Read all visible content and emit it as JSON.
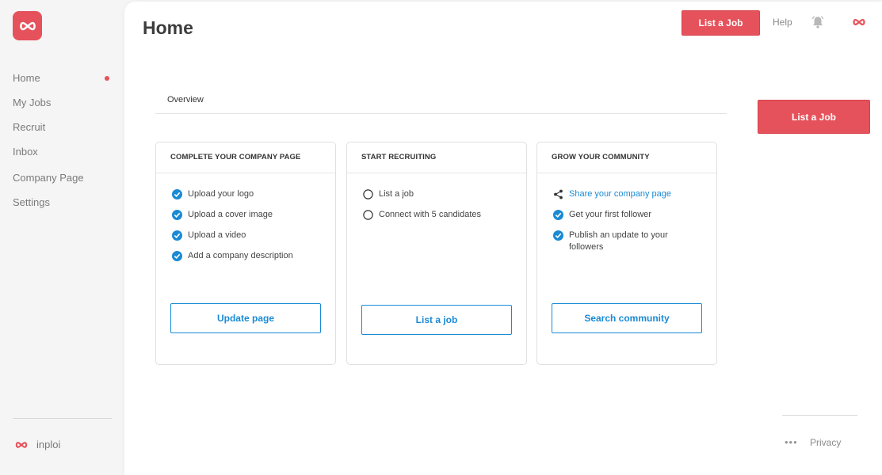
{
  "sidebar": {
    "items": [
      {
        "label": "Home"
      },
      {
        "label": "My Jobs"
      },
      {
        "label": "Recruit"
      },
      {
        "label": "Inbox"
      },
      {
        "label": "Company Page"
      },
      {
        "label": "Settings"
      }
    ],
    "brand": "inploi"
  },
  "header": {
    "title": "Home",
    "list_job": "List a Job",
    "help": "Help"
  },
  "tabs": [
    {
      "label": "Overview"
    }
  ],
  "side_button": "List a Job",
  "cards": [
    {
      "title": "COMPLETE YOUR COMPANY PAGE",
      "items": [
        {
          "text": "Upload your logo",
          "icon": "check-circle-icon"
        },
        {
          "text": "Upload a cover image",
          "icon": "check-circle-icon"
        },
        {
          "text": "Upload a video",
          "icon": "check-circle-icon"
        },
        {
          "text": "Add a company description",
          "icon": "check-circle-icon"
        }
      ],
      "button": "Update page"
    },
    {
      "title": "START RECRUITING",
      "items": [
        {
          "text": "List a job",
          "icon": "empty-circle-icon"
        },
        {
          "text": "Connect with 5 candidates",
          "icon": "empty-circle-icon"
        }
      ],
      "button": "List a job"
    },
    {
      "title": "GROW YOUR COMMUNITY",
      "items": [
        {
          "text": "Share your company page",
          "icon": "share-icon"
        },
        {
          "text": "Get your first follower",
          "icon": "check-circle-icon"
        },
        {
          "text": "Publish an update to your followers",
          "icon": "check-circle-icon"
        }
      ],
      "button": "Search community"
    }
  ],
  "footer": {
    "more": "•••",
    "privacy": "Privacy"
  },
  "colors": {
    "accent": "#e6525b",
    "link": "#1a8ad4"
  }
}
